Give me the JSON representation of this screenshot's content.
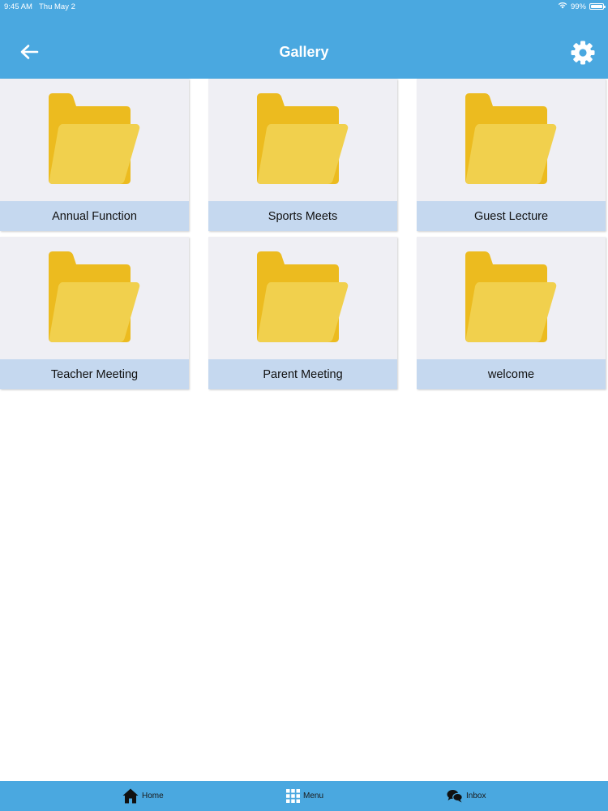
{
  "status_bar": {
    "time": "9:45 AM",
    "date": "Thu May 2",
    "battery": "99%",
    "battery_level": 0.99
  },
  "header": {
    "title": "Gallery",
    "background_color": "#4aa8e0",
    "back_icon": "arrow-left-icon",
    "settings_icon": "gear-icon"
  },
  "albums": [
    {
      "label": "Annual Function",
      "icon": "folder-icon"
    },
    {
      "label": "Sports Meets",
      "icon": "folder-icon"
    },
    {
      "label": "Guest Lecture",
      "icon": "folder-icon"
    },
    {
      "label": "Teacher Meeting",
      "icon": "folder-icon"
    },
    {
      "label": "Parent Meeting",
      "icon": "folder-icon"
    },
    {
      "label": "welcome",
      "icon": "folder-icon"
    }
  ],
  "tab_bar": {
    "items": [
      {
        "label": "Home",
        "icon": "home-icon"
      },
      {
        "label": "Menu",
        "icon": "grid-icon"
      },
      {
        "label": "Inbox",
        "icon": "chat-bubbles-icon"
      }
    ]
  },
  "colors": {
    "accent": "#4aa8e0",
    "card_background": "#efeff4",
    "label_background": "#c5d8ef",
    "folder_back": "#ecbb1f",
    "folder_front": "#f1d04d"
  }
}
